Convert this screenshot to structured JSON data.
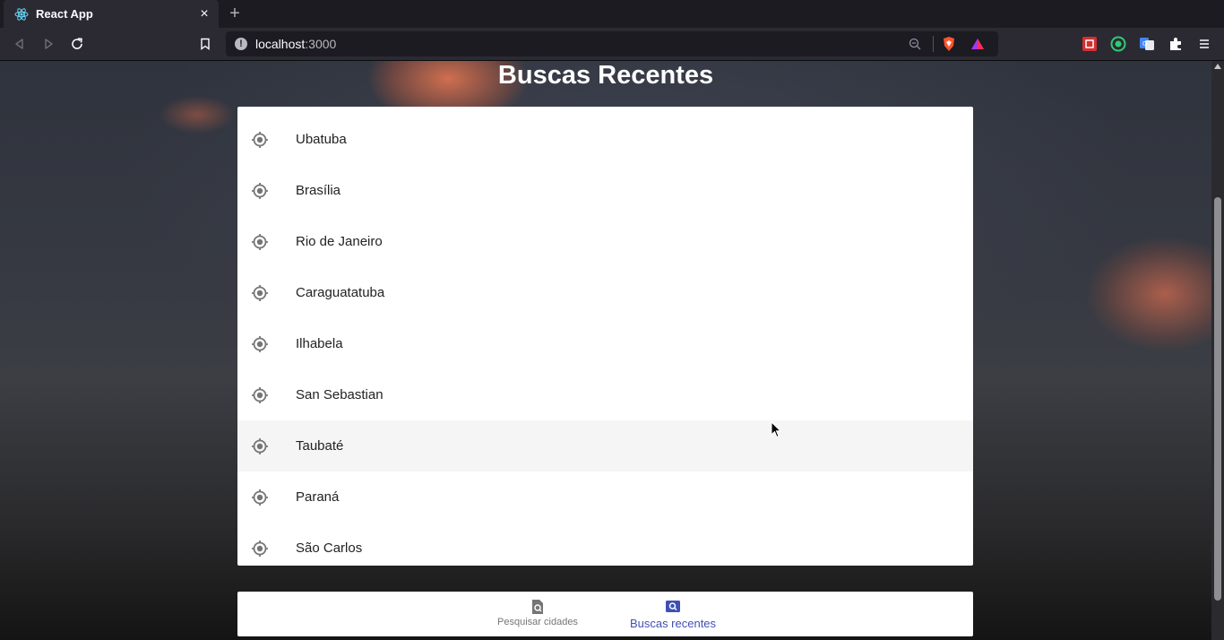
{
  "browser": {
    "tab_title": "React App",
    "tab_close": "×",
    "new_tab": "+",
    "url_host": "localhost",
    "url_port": ":3000"
  },
  "page": {
    "title": "Buscas Recentes"
  },
  "recent_searches": [
    {
      "label": "Ubatuba",
      "icon": "gps-fixed-icon"
    },
    {
      "label": "Brasília",
      "icon": "gps-fixed-icon"
    },
    {
      "label": "Rio de Janeiro",
      "icon": "gps-fixed-icon"
    },
    {
      "label": "Caraguatatuba",
      "icon": "gps-fixed-icon"
    },
    {
      "label": "Ilhabela",
      "icon": "gps-fixed-icon"
    },
    {
      "label": "San Sebastian",
      "icon": "gps-fixed-icon"
    },
    {
      "label": "Taubaté",
      "icon": "gps-fixed-icon"
    },
    {
      "label": "Paraná",
      "icon": "gps-fixed-icon"
    },
    {
      "label": "São Carlos",
      "icon": "gps-fixed-icon"
    }
  ],
  "bottom_nav": {
    "search_cities": "Pesquisar cidades",
    "recent_searches": "Buscas recentes"
  },
  "colors": {
    "accent": "#3f51b5",
    "inactive": "#757575"
  }
}
